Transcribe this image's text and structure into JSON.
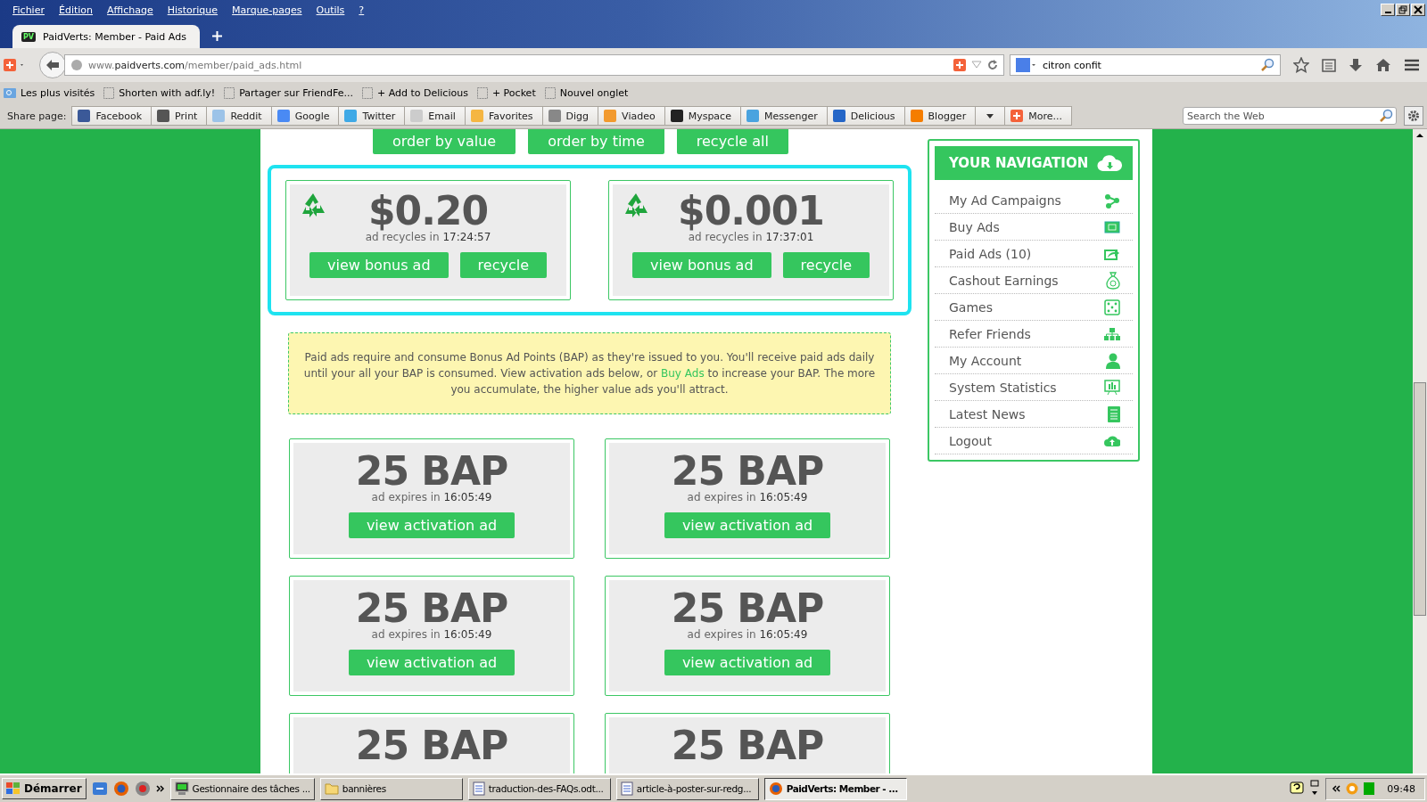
{
  "menu_bar": [
    "Fichier",
    "Édition",
    "Affichage",
    "Historique",
    "Marque-pages",
    "Outils",
    "?"
  ],
  "tabs": [
    {
      "title": "PaidVerts: Member - Paid Ads",
      "favicon": "PV",
      "selected": true
    }
  ],
  "address_bar": {
    "url": "www.**paidverts.com**/member/paid_ads.html"
  },
  "search_bar": {
    "value": "citron confit"
  },
  "bookmarks": [
    {
      "label": "Les plus visités",
      "kind": "folder"
    },
    {
      "label": "Shorten with adf.ly!",
      "kind": "page"
    },
    {
      "label": "Partager sur FriendFe...",
      "kind": "page"
    },
    {
      "label": "+ Add to Delicious",
      "kind": "page"
    },
    {
      "label": "+ Pocket",
      "kind": "page"
    },
    {
      "label": "Nouvel onglet",
      "kind": "page"
    }
  ],
  "share_bar": {
    "label": "Share page:",
    "items": [
      "Facebook",
      "Print",
      "Reddit",
      "Google",
      "Twitter",
      "Email",
      "Favorites",
      "Digg",
      "Viadeo",
      "Myspace",
      "Messenger",
      "Delicious",
      "Blogger"
    ],
    "more": "More...",
    "search_placeholder": "Search the Web"
  },
  "sort_buttons": [
    "order by value",
    "order by time",
    "recycle all"
  ],
  "bonus_ads": [
    {
      "amount": "$0.20",
      "caption": "ad recycles in **17:24:57**",
      "buttons": [
        "view bonus ad",
        "recycle"
      ]
    },
    {
      "amount": "$0.001",
      "caption": "ad recycles in **17:37:01**",
      "buttons": [
        "view bonus ad",
        "recycle"
      ]
    }
  ],
  "notice": {
    "before": "Paid ads require and consume Bonus Ad Points (BAP) as they're issued to you. You'll receive paid ads daily until your all your BAP is consumed. View activation ads below, or ",
    "link": "Buy Ads",
    "after": " to increase your BAP. The more you accumulate, the higher value ads you'll attract."
  },
  "activation_ads": [
    {
      "amount": "25 BAP",
      "caption": "ad expires in **16:05:49**",
      "button": "view activation ad"
    },
    {
      "amount": "25 BAP",
      "caption": "ad expires in **16:05:49**",
      "button": "view activation ad"
    },
    {
      "amount": "25 BAP",
      "caption": "ad expires in **16:05:49**",
      "button": "view activation ad"
    },
    {
      "amount": "25 BAP",
      "caption": "ad expires in **16:05:49**",
      "button": "view activation ad"
    },
    {
      "amount": "25 BAP"
    },
    {
      "amount": "25 BAP"
    }
  ],
  "navigation": {
    "title": "YOUR NAVIGATION",
    "items": [
      {
        "label": "My Ad Campaigns",
        "kind": "share"
      },
      {
        "label": "Buy Ads",
        "kind": "money"
      },
      {
        "label": "Paid Ads (10)",
        "kind": "forward"
      },
      {
        "label": "Cashout Earnings",
        "kind": "bag"
      },
      {
        "label": "Games",
        "kind": "dice"
      },
      {
        "label": "Refer Friends",
        "kind": "tree"
      },
      {
        "label": "My Account",
        "kind": "user"
      },
      {
        "label": "System Statistics",
        "kind": "board"
      },
      {
        "label": "Latest News",
        "kind": "news"
      },
      {
        "label": "Logout",
        "kind": "cloud"
      }
    ]
  },
  "taskbar": {
    "start": "Démarrer",
    "tasks": [
      {
        "label": "Gestionnaire des tâches ...",
        "kind": "monitor",
        "selected": false
      },
      {
        "label": "bannières",
        "kind": "folder",
        "selected": false
      },
      {
        "label": "traduction-des-FAQs.odt...",
        "kind": "doc",
        "selected": false
      },
      {
        "label": "article-à-poster-sur-redg...",
        "kind": "doc",
        "selected": false
      },
      {
        "label": "PaidVerts: Member - ...",
        "kind": "browser",
        "selected": true
      }
    ],
    "clock": "09:48"
  }
}
